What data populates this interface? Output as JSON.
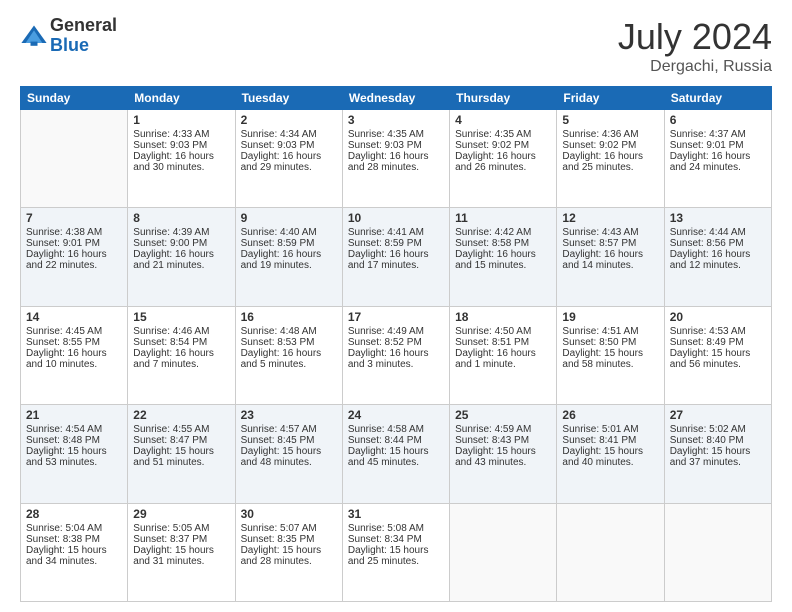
{
  "logo": {
    "general": "General",
    "blue": "Blue"
  },
  "title": {
    "month_year": "July 2024",
    "location": "Dergachi, Russia"
  },
  "days_of_week": [
    "Sunday",
    "Monday",
    "Tuesday",
    "Wednesday",
    "Thursday",
    "Friday",
    "Saturday"
  ],
  "weeks": [
    [
      {
        "day": "",
        "sunrise": "",
        "sunset": "",
        "daylight": ""
      },
      {
        "day": "1",
        "sunrise": "Sunrise: 4:33 AM",
        "sunset": "Sunset: 9:03 PM",
        "daylight": "Daylight: 16 hours and 30 minutes."
      },
      {
        "day": "2",
        "sunrise": "Sunrise: 4:34 AM",
        "sunset": "Sunset: 9:03 PM",
        "daylight": "Daylight: 16 hours and 29 minutes."
      },
      {
        "day": "3",
        "sunrise": "Sunrise: 4:35 AM",
        "sunset": "Sunset: 9:03 PM",
        "daylight": "Daylight: 16 hours and 28 minutes."
      },
      {
        "day": "4",
        "sunrise": "Sunrise: 4:35 AM",
        "sunset": "Sunset: 9:02 PM",
        "daylight": "Daylight: 16 hours and 26 minutes."
      },
      {
        "day": "5",
        "sunrise": "Sunrise: 4:36 AM",
        "sunset": "Sunset: 9:02 PM",
        "daylight": "Daylight: 16 hours and 25 minutes."
      },
      {
        "day": "6",
        "sunrise": "Sunrise: 4:37 AM",
        "sunset": "Sunset: 9:01 PM",
        "daylight": "Daylight: 16 hours and 24 minutes."
      }
    ],
    [
      {
        "day": "7",
        "sunrise": "Sunrise: 4:38 AM",
        "sunset": "Sunset: 9:01 PM",
        "daylight": "Daylight: 16 hours and 22 minutes."
      },
      {
        "day": "8",
        "sunrise": "Sunrise: 4:39 AM",
        "sunset": "Sunset: 9:00 PM",
        "daylight": "Daylight: 16 hours and 21 minutes."
      },
      {
        "day": "9",
        "sunrise": "Sunrise: 4:40 AM",
        "sunset": "Sunset: 8:59 PM",
        "daylight": "Daylight: 16 hours and 19 minutes."
      },
      {
        "day": "10",
        "sunrise": "Sunrise: 4:41 AM",
        "sunset": "Sunset: 8:59 PM",
        "daylight": "Daylight: 16 hours and 17 minutes."
      },
      {
        "day": "11",
        "sunrise": "Sunrise: 4:42 AM",
        "sunset": "Sunset: 8:58 PM",
        "daylight": "Daylight: 16 hours and 15 minutes."
      },
      {
        "day": "12",
        "sunrise": "Sunrise: 4:43 AM",
        "sunset": "Sunset: 8:57 PM",
        "daylight": "Daylight: 16 hours and 14 minutes."
      },
      {
        "day": "13",
        "sunrise": "Sunrise: 4:44 AM",
        "sunset": "Sunset: 8:56 PM",
        "daylight": "Daylight: 16 hours and 12 minutes."
      }
    ],
    [
      {
        "day": "14",
        "sunrise": "Sunrise: 4:45 AM",
        "sunset": "Sunset: 8:55 PM",
        "daylight": "Daylight: 16 hours and 10 minutes."
      },
      {
        "day": "15",
        "sunrise": "Sunrise: 4:46 AM",
        "sunset": "Sunset: 8:54 PM",
        "daylight": "Daylight: 16 hours and 7 minutes."
      },
      {
        "day": "16",
        "sunrise": "Sunrise: 4:48 AM",
        "sunset": "Sunset: 8:53 PM",
        "daylight": "Daylight: 16 hours and 5 minutes."
      },
      {
        "day": "17",
        "sunrise": "Sunrise: 4:49 AM",
        "sunset": "Sunset: 8:52 PM",
        "daylight": "Daylight: 16 hours and 3 minutes."
      },
      {
        "day": "18",
        "sunrise": "Sunrise: 4:50 AM",
        "sunset": "Sunset: 8:51 PM",
        "daylight": "Daylight: 16 hours and 1 minute."
      },
      {
        "day": "19",
        "sunrise": "Sunrise: 4:51 AM",
        "sunset": "Sunset: 8:50 PM",
        "daylight": "Daylight: 15 hours and 58 minutes."
      },
      {
        "day": "20",
        "sunrise": "Sunrise: 4:53 AM",
        "sunset": "Sunset: 8:49 PM",
        "daylight": "Daylight: 15 hours and 56 minutes."
      }
    ],
    [
      {
        "day": "21",
        "sunrise": "Sunrise: 4:54 AM",
        "sunset": "Sunset: 8:48 PM",
        "daylight": "Daylight: 15 hours and 53 minutes."
      },
      {
        "day": "22",
        "sunrise": "Sunrise: 4:55 AM",
        "sunset": "Sunset: 8:47 PM",
        "daylight": "Daylight: 15 hours and 51 minutes."
      },
      {
        "day": "23",
        "sunrise": "Sunrise: 4:57 AM",
        "sunset": "Sunset: 8:45 PM",
        "daylight": "Daylight: 15 hours and 48 minutes."
      },
      {
        "day": "24",
        "sunrise": "Sunrise: 4:58 AM",
        "sunset": "Sunset: 8:44 PM",
        "daylight": "Daylight: 15 hours and 45 minutes."
      },
      {
        "day": "25",
        "sunrise": "Sunrise: 4:59 AM",
        "sunset": "Sunset: 8:43 PM",
        "daylight": "Daylight: 15 hours and 43 minutes."
      },
      {
        "day": "26",
        "sunrise": "Sunrise: 5:01 AM",
        "sunset": "Sunset: 8:41 PM",
        "daylight": "Daylight: 15 hours and 40 minutes."
      },
      {
        "day": "27",
        "sunrise": "Sunrise: 5:02 AM",
        "sunset": "Sunset: 8:40 PM",
        "daylight": "Daylight: 15 hours and 37 minutes."
      }
    ],
    [
      {
        "day": "28",
        "sunrise": "Sunrise: 5:04 AM",
        "sunset": "Sunset: 8:38 PM",
        "daylight": "Daylight: 15 hours and 34 minutes."
      },
      {
        "day": "29",
        "sunrise": "Sunrise: 5:05 AM",
        "sunset": "Sunset: 8:37 PM",
        "daylight": "Daylight: 15 hours and 31 minutes."
      },
      {
        "day": "30",
        "sunrise": "Sunrise: 5:07 AM",
        "sunset": "Sunset: 8:35 PM",
        "daylight": "Daylight: 15 hours and 28 minutes."
      },
      {
        "day": "31",
        "sunrise": "Sunrise: 5:08 AM",
        "sunset": "Sunset: 8:34 PM",
        "daylight": "Daylight: 15 hours and 25 minutes."
      },
      {
        "day": "",
        "sunrise": "",
        "sunset": "",
        "daylight": ""
      },
      {
        "day": "",
        "sunrise": "",
        "sunset": "",
        "daylight": ""
      },
      {
        "day": "",
        "sunrise": "",
        "sunset": "",
        "daylight": ""
      }
    ]
  ]
}
